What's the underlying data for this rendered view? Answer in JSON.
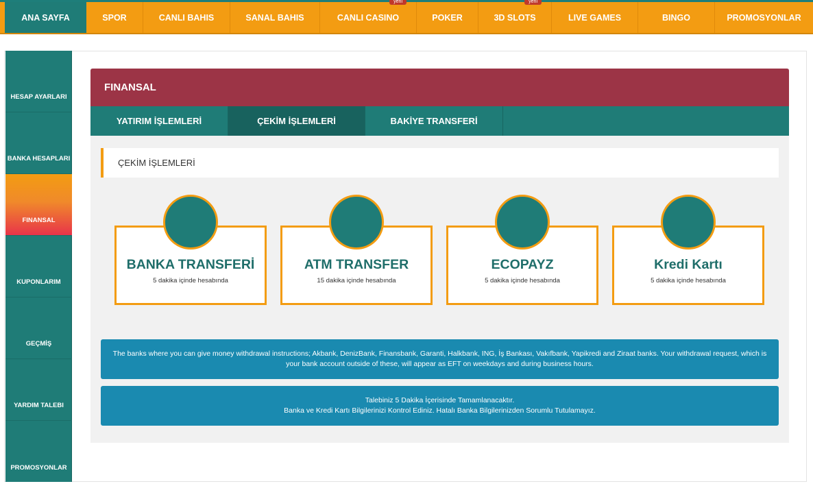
{
  "topnav": {
    "items": [
      {
        "label": "ANA SAYFA"
      },
      {
        "label": "SPOR"
      },
      {
        "label": "CANLI BAHIS"
      },
      {
        "label": "SANAL BAHIS"
      },
      {
        "label": "CANLI CASINO",
        "badge": "yeni"
      },
      {
        "label": "POKER"
      },
      {
        "label": "3D SLOTS",
        "badge": "yeni"
      },
      {
        "label": "LIVE GAMES"
      },
      {
        "label": "BINGO"
      },
      {
        "label": "PROMOSYONLAR"
      }
    ]
  },
  "sidebar": {
    "items": [
      {
        "label": "HESAP AYARLARI"
      },
      {
        "label": "BANKA HESAPLARI"
      },
      {
        "label": "FINANSAL"
      },
      {
        "label": "KUPONLARIM"
      },
      {
        "label": "GEÇMİŞ"
      },
      {
        "label": "YARDIM TALEBI"
      },
      {
        "label": "PROMOSYONLAR"
      }
    ]
  },
  "panel": {
    "title": "FINANSAL",
    "tabs": [
      {
        "label": "YATIRIM İŞLEMLERİ"
      },
      {
        "label": "ÇEKİM İŞLEMLERİ"
      },
      {
        "label": "BAKİYE TRANSFERİ"
      }
    ],
    "section_title": "ÇEKİM İŞLEMLERİ",
    "methods": [
      {
        "title": "BANKA TRANSFERİ",
        "subtitle": "5 dakika içinde hesabında"
      },
      {
        "title": "ATM TRANSFER",
        "subtitle": "15 dakika içinde hesabında"
      },
      {
        "title": "ECOPAYZ",
        "subtitle": "5 dakika içinde hesabında"
      },
      {
        "title": "Kredi Kartı",
        "subtitle": "5 dakika içinde hesabında"
      }
    ],
    "notice_banks": "The banks where you can give money withdrawal instructions; Akbank, DenizBank, Finansbank, Garanti, Halkbank, ING, İş Bankası, Vakıfbank, Yapikredi and Ziraat banks. Your withdrawal request, which is your bank account outside of these, will appear as EFT on weekdays and during business hours.",
    "notice_time_line1": "Talebiniz 5 Dakika İçerisinde Tamamlanacaktır.",
    "notice_time_line2": "Banka ve Kredi Kartı Bilgilerinizi Kontrol Ediniz. Hatalı Banka Bilgilerinizden Sorumlu Tutulamayız."
  },
  "colors": {
    "teal": "#1f7c77",
    "orange": "#f39c12",
    "crimson": "#9c3446",
    "info_blue": "#1a8ab0"
  }
}
